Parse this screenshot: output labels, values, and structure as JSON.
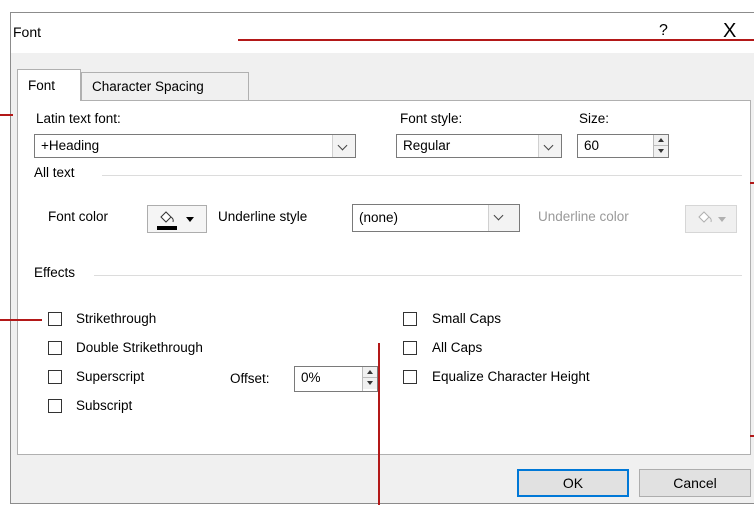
{
  "dialog": {
    "title": "Font",
    "help": "?",
    "close": "X"
  },
  "tabs": [
    {
      "label": "Font",
      "active": true
    },
    {
      "label": "Character Spacing",
      "active": false
    }
  ],
  "latin_text_font": {
    "label": "Latin text font:",
    "value": "+Heading"
  },
  "font_style": {
    "label": "Font style:",
    "value": "Regular"
  },
  "size": {
    "label": "Size:",
    "value": "60"
  },
  "all_text": {
    "label": "All text",
    "font_color_label": "Font color",
    "underline_style_label": "Underline style",
    "underline_style_value": "(none)",
    "underline_color_label": "Underline color"
  },
  "effects": {
    "label": "Effects",
    "left": [
      "Strikethrough",
      "Double Strikethrough",
      "Superscript",
      "Subscript"
    ],
    "right": [
      "Small Caps",
      "All Caps",
      "Equalize Character Height"
    ],
    "offset_label": "Offset:",
    "offset_value": "0%"
  },
  "buttons": {
    "ok": "OK",
    "cancel": "Cancel"
  },
  "colors": {
    "accent": "#0078d7",
    "callout": "#b31818"
  }
}
